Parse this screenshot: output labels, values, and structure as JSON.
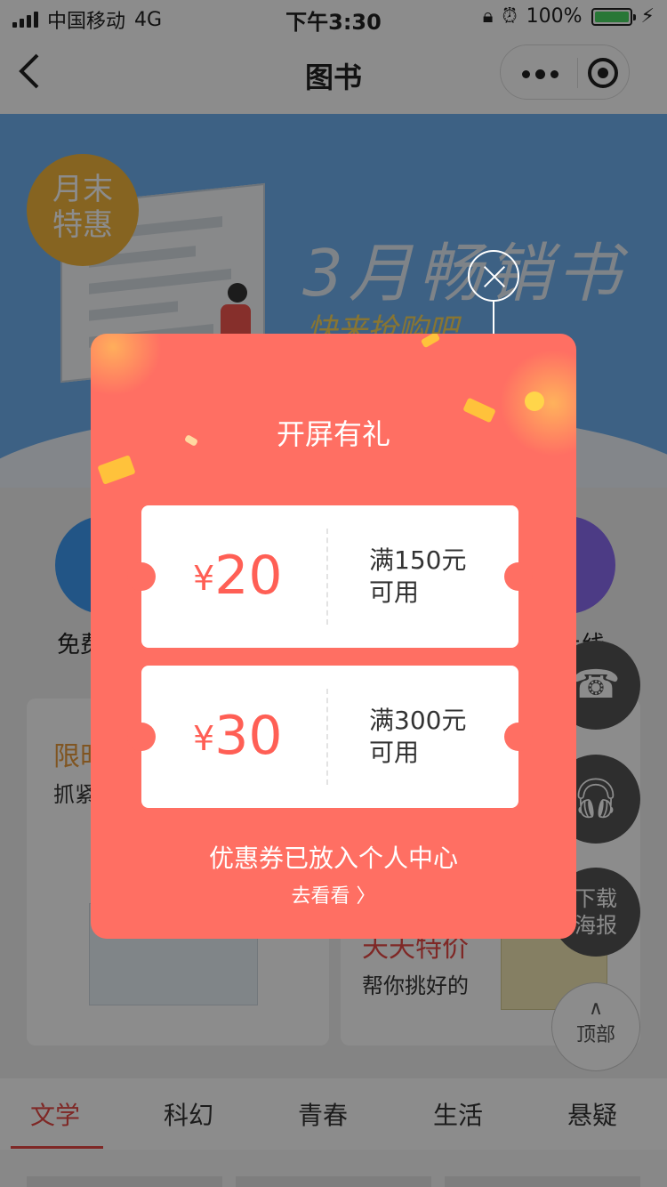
{
  "status_bar": {
    "carrier": "中国移动",
    "network": "4G",
    "time": "下午3:30",
    "battery": "100%",
    "battery_level": 1.0
  },
  "nav": {
    "title": "图书",
    "back_icon": "chevron-left-icon",
    "more_icon": "more-dots-icon",
    "close_icon": "target-icon"
  },
  "banner": {
    "badge": "月末\n特惠",
    "title": "3月畅销书",
    "subtitle": "快来抢购吧"
  },
  "categories": {
    "left_label": "免费",
    "right_label": "上线"
  },
  "cards": {
    "left_title": "限时",
    "left_sub": "抓紧",
    "right_title": "天天特价",
    "right_sub": "帮你挑好的"
  },
  "float_buttons": {
    "poster": "下载\n海报",
    "top": "顶部"
  },
  "tabs": [
    {
      "label": "文学",
      "active": true
    },
    {
      "label": "科幻",
      "active": false
    },
    {
      "label": "青春",
      "active": false
    },
    {
      "label": "生活",
      "active": false
    },
    {
      "label": "悬疑",
      "active": false
    }
  ],
  "modal": {
    "title": "开屏有礼",
    "coupons": [
      {
        "currency": "¥",
        "amount": "20",
        "condition_line1": "满150元",
        "condition_line2": "可用"
      },
      {
        "currency": "¥",
        "amount": "30",
        "condition_line1": "满300元",
        "condition_line2": "可用"
      }
    ],
    "note": "优惠券已放入个人中心",
    "link": "去看看 〉"
  },
  "colors": {
    "modal_bg": "#ff6f63",
    "coupon_amount": "#ff5f55",
    "tab_active": "#e84a45"
  }
}
